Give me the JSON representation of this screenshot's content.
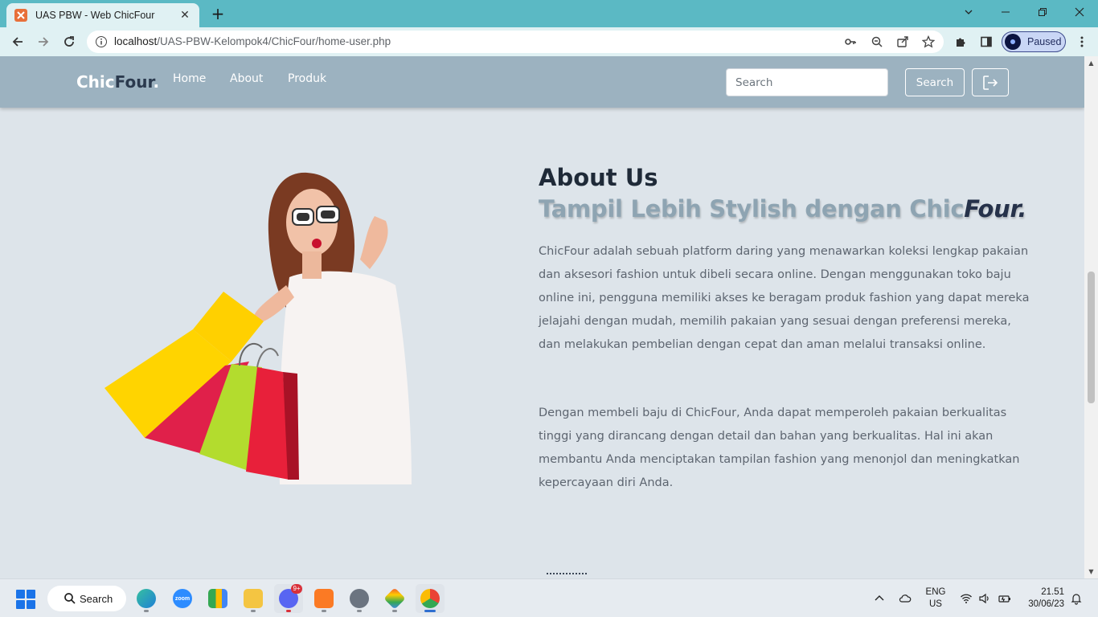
{
  "browser": {
    "tab_title": "UAS PBW - Web ChicFour",
    "url_host": "localhost",
    "url_path": "/UAS-PBW-Kelompok4/ChicFour/home-user.php",
    "profile_status": "Paused"
  },
  "navbar": {
    "brand_part1": "Chic",
    "brand_part2": "Four",
    "brand_dot": ".",
    "links": [
      "Home",
      "About",
      "Produk"
    ],
    "search_placeholder": "Search",
    "search_button": "Search",
    "colors": {
      "bar": "#9cb2c0",
      "brand_dark": "#2b3a4e"
    }
  },
  "about": {
    "heading": "About Us",
    "subheading_main": "Tampil Lebih Stylish dengan Chic",
    "subheading_accent": "Four.",
    "paragraph1": "ChicFour adalah sebuah platform daring yang menawarkan koleksi lengkap pakaian dan aksesori fashion untuk dibeli secara online. Dengan menggunakan toko baju online ini, pengguna memiliki akses ke beragam produk fashion yang dapat mereka jelajahi dengan mudah, memilih pakaian yang sesuai dengan preferensi mereka, dan melakukan pembelian dengan cepat dan aman melalui transaksi online.",
    "paragraph2": "Dengan membeli baju di ChicFour, Anda dapat memperoleh pakaian berkualitas tinggi yang dirancang dengan detail dan bahan yang berkualitas. Hal ini akan membantu Anda menciptakan tampilan fashion yang menonjol dan meningkatkan kepercayaan diri Anda.",
    "image_icon": "woman-with-shopping-bags"
  },
  "taskbar": {
    "search_label": "Search",
    "apps": [
      "edge-icon",
      "zoom-icon",
      "meet-icon",
      "file-explorer-icon",
      "discord-icon",
      "xampp-icon",
      "settings-icon",
      "git-icon",
      "chrome-icon"
    ],
    "zoom_label": "zoom",
    "discord_badge": "9+",
    "lang_line1": "ENG",
    "lang_line2": "US",
    "time": "21.51",
    "date": "30/06/23"
  }
}
